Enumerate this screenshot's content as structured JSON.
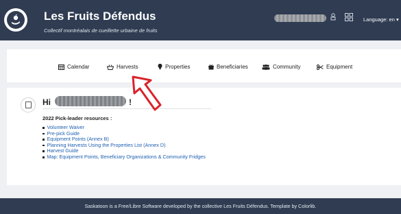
{
  "brand": {
    "title": "Les Fruits Défendus",
    "subtitle": "Collectif montréalais de cueillette urbaine de fruits"
  },
  "header": {
    "language_label": "Language: en"
  },
  "nav": {
    "items": [
      {
        "label": "Calendar",
        "icon": "calendar-icon"
      },
      {
        "label": "Harvests",
        "icon": "basket-icon"
      },
      {
        "label": "Properties",
        "icon": "map-pin-icon"
      },
      {
        "label": "Beneficiaries",
        "icon": "gift-icon"
      },
      {
        "label": "Community",
        "icon": "users-icon"
      },
      {
        "label": "Equipment",
        "icon": "scissors-icon"
      }
    ]
  },
  "main": {
    "greeting_prefix": "Hi",
    "greeting_suffix": "!",
    "resources_heading": "2022 Pick-leader resources :",
    "resources": [
      "Volunteer Waiver",
      "Pre-pick Guide",
      "Equipment Points (Annex B)",
      "Planning Harvests Using the Properties List (Annex D)",
      "Harvest Guide",
      "Map: Equipment Points, Beneficiary Organizations & Community Fridges"
    ]
  },
  "footer": {
    "text": "Saskatoon is a Free/Libre Software developed by the collective Les Fruits Défendus. Template by Colorlib."
  },
  "colors": {
    "header_bg": "#2f3c52",
    "link": "#1d5fb0",
    "annotation_arrow": "#d9232a"
  }
}
